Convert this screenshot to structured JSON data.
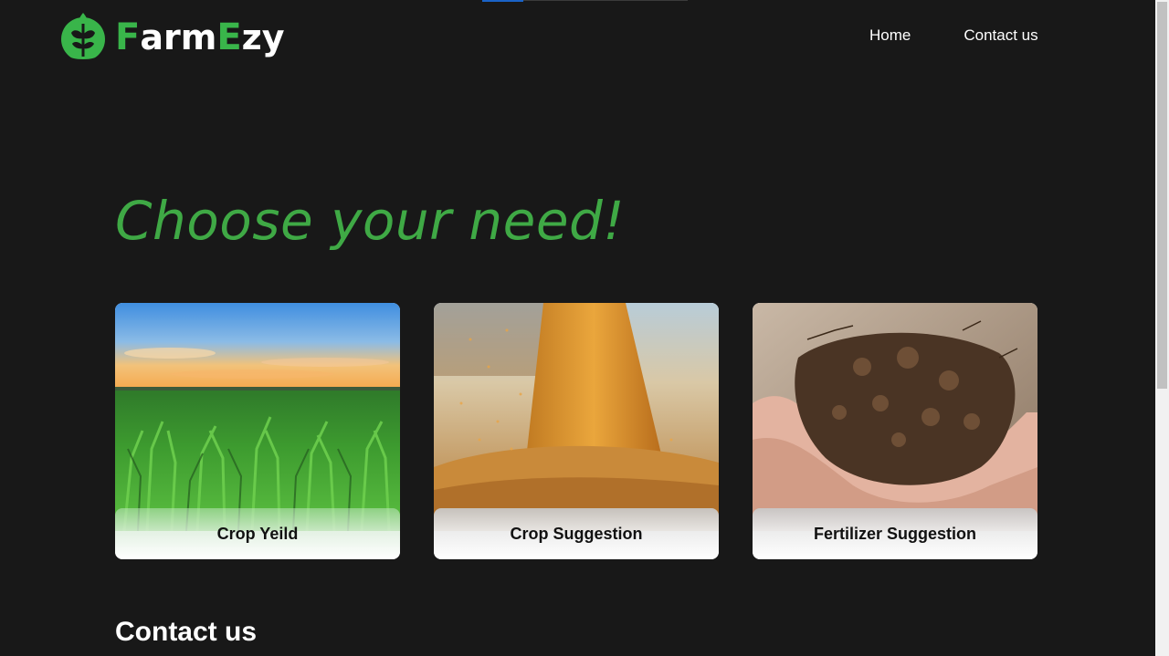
{
  "brand": {
    "letters": [
      {
        "text": "F",
        "color": "green"
      },
      {
        "text": "arm",
        "color": "white"
      },
      {
        "text": "E",
        "color": "green"
      },
      {
        "text": "zy",
        "color": "white"
      }
    ],
    "icon": "leaf-sprout-icon",
    "accent_color": "#39b54a"
  },
  "nav": {
    "items": [
      {
        "label": "Home"
      },
      {
        "label": "Contact us"
      }
    ]
  },
  "hero": {
    "title": "Choose your need!",
    "title_color": "#3fa945"
  },
  "cards": [
    {
      "label": "Crop Yeild",
      "image": "corn-field-sunset-image"
    },
    {
      "label": "Crop Suggestion",
      "image": "falling-grain-image"
    },
    {
      "label": "Fertilizer Suggestion",
      "image": "hands-holding-soil-image"
    }
  ],
  "contact": {
    "title": "Contact us"
  },
  "colors": {
    "background": "#181818",
    "text": "#ffffff"
  }
}
